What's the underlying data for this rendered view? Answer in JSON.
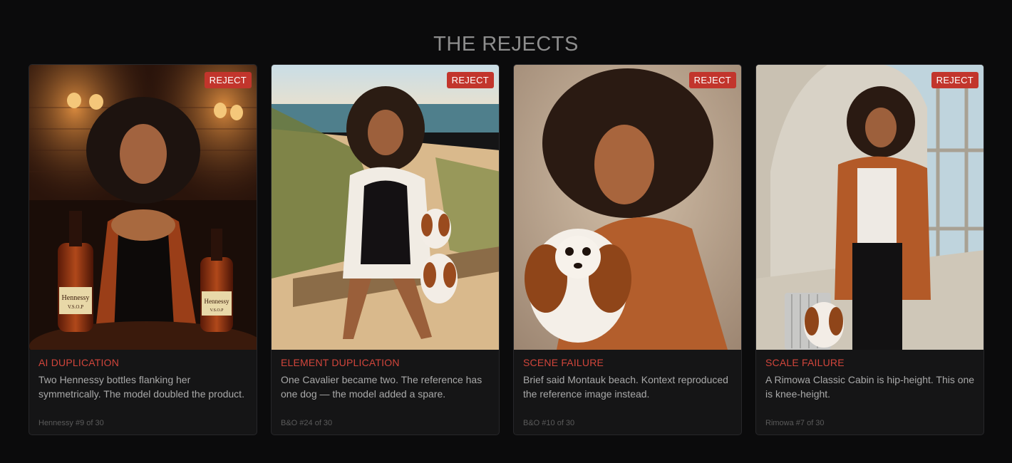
{
  "page": {
    "title": "THE REJECTS"
  },
  "badge_label": "REJECT",
  "colors": {
    "background": "#0b0b0c",
    "card": "#151516",
    "accent_red": "#c2352c",
    "category_red": "#d1453b"
  },
  "cards": [
    {
      "category": "AI DUPLICATION",
      "description": "Two Hennessy bottles flanking her symmetrically. The model doubled the product.",
      "meta": "Hennessy #9 of 30",
      "image": "woman-with-two-hennessy-bottles-photo",
      "bottle_label": "Hennessy",
      "bottle_sub": "V.S.O.P"
    },
    {
      "category": "ELEMENT DUPLICATION",
      "description": "One Cavalier became two. The reference has one dog — the model added a spare.",
      "meta": "B&O #24 of 30",
      "image": "woman-on-beach-bench-with-two-dogs-photo"
    },
    {
      "category": "SCENE FAILURE",
      "description": "Brief said Montauk beach. Kontext reproduced the reference image instead.",
      "meta": "B&O #10 of 30",
      "image": "woman-holding-cavalier-studio-photo"
    },
    {
      "category": "SCALE FAILURE",
      "description": "A Rimowa Classic Cabin is hip-height. This one is knee-height.",
      "meta": "Rimowa #7 of 30",
      "image": "woman-in-airport-with-suitcase-photo"
    }
  ]
}
